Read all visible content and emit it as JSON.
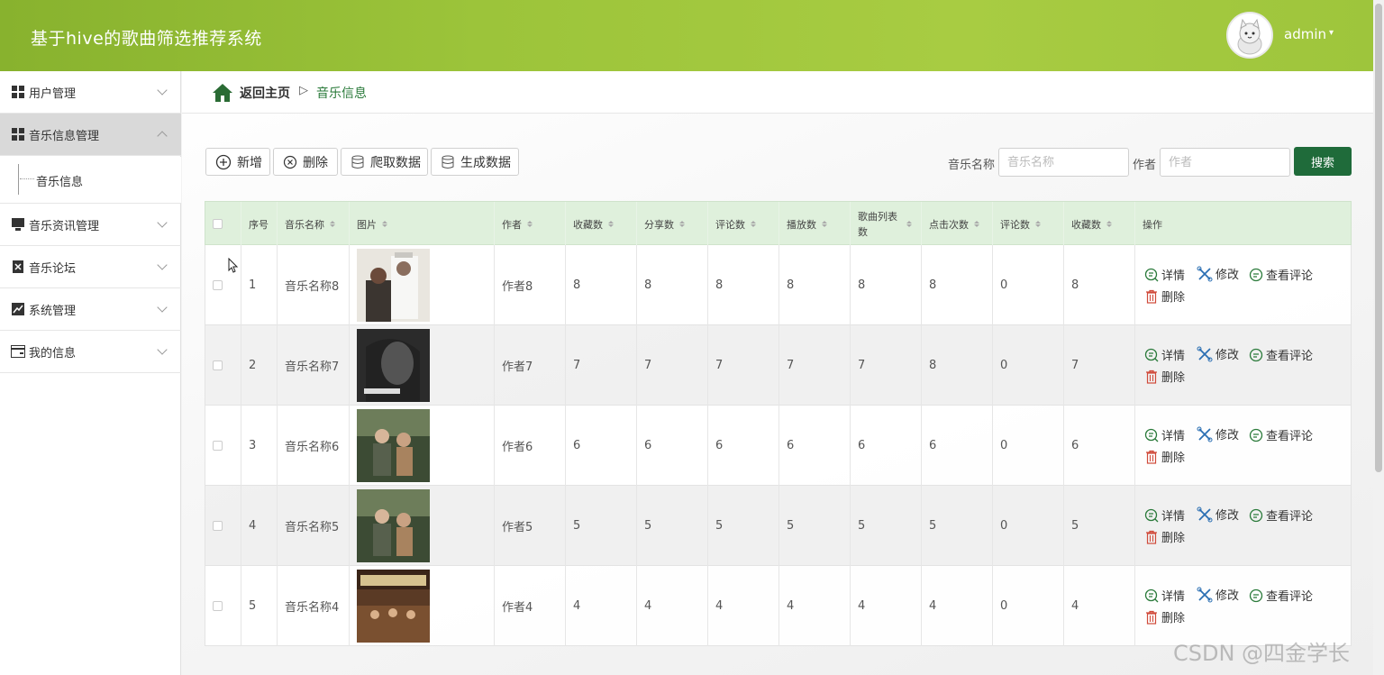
{
  "app": {
    "title": "基于hive的歌曲筛选推荐系统",
    "user": "admin",
    "watermark": "CSDN @四金学长"
  },
  "sidebar": {
    "items": [
      {
        "label": "用户管理"
      },
      {
        "label": "音乐信息管理"
      },
      {
        "label": "音乐资讯管理"
      },
      {
        "label": "音乐论坛"
      },
      {
        "label": "系统管理"
      },
      {
        "label": "我的信息"
      }
    ],
    "sub_item": "音乐信息"
  },
  "breadcrumb": {
    "home": "返回主页",
    "sep": "▷",
    "current": "音乐信息"
  },
  "toolbar": {
    "add": "新增",
    "delete": "删除",
    "crawl": "爬取数据",
    "generate": "生成数据"
  },
  "search": {
    "name_label": "音乐名称",
    "name_placeholder": "音乐名称",
    "author_label": "作者",
    "author_placeholder": "作者",
    "button": "搜索"
  },
  "table": {
    "headers": [
      "序号",
      "音乐名称",
      "图片",
      "作者",
      "收藏数",
      "分享数",
      "评论数",
      "播放数",
      "歌曲列表数",
      "点击次数",
      "评论数",
      "收藏数",
      "操作"
    ],
    "actions": {
      "detail": "详情",
      "edit": "修改",
      "comments": "查看评论",
      "delete": "删除"
    },
    "rows": [
      {
        "idx": "1",
        "name": "音乐名称8",
        "author": "作者8",
        "fav": "8",
        "share": "8",
        "comment": "8",
        "play": "8",
        "playlist": "8",
        "clicks": "8",
        "comment2": "0",
        "fav2": "8"
      },
      {
        "idx": "2",
        "name": "音乐名称7",
        "author": "作者7",
        "fav": "7",
        "share": "7",
        "comment": "7",
        "play": "7",
        "playlist": "7",
        "clicks": "8",
        "comment2": "0",
        "fav2": "7"
      },
      {
        "idx": "3",
        "name": "音乐名称6",
        "author": "作者6",
        "fav": "6",
        "share": "6",
        "comment": "6",
        "play": "6",
        "playlist": "6",
        "clicks": "6",
        "comment2": "0",
        "fav2": "6"
      },
      {
        "idx": "4",
        "name": "音乐名称5",
        "author": "作者5",
        "fav": "5",
        "share": "5",
        "comment": "5",
        "play": "5",
        "playlist": "5",
        "clicks": "5",
        "comment2": "0",
        "fav2": "5"
      },
      {
        "idx": "5",
        "name": "音乐名称4",
        "author": "作者4",
        "fav": "4",
        "share": "4",
        "comment": "4",
        "play": "4",
        "playlist": "4",
        "clicks": "4",
        "comment2": "0",
        "fav2": "4"
      }
    ]
  },
  "colors": {
    "header": "#9cc43a",
    "accent": "#1f6b3a",
    "table_head": "#dff0dc"
  }
}
